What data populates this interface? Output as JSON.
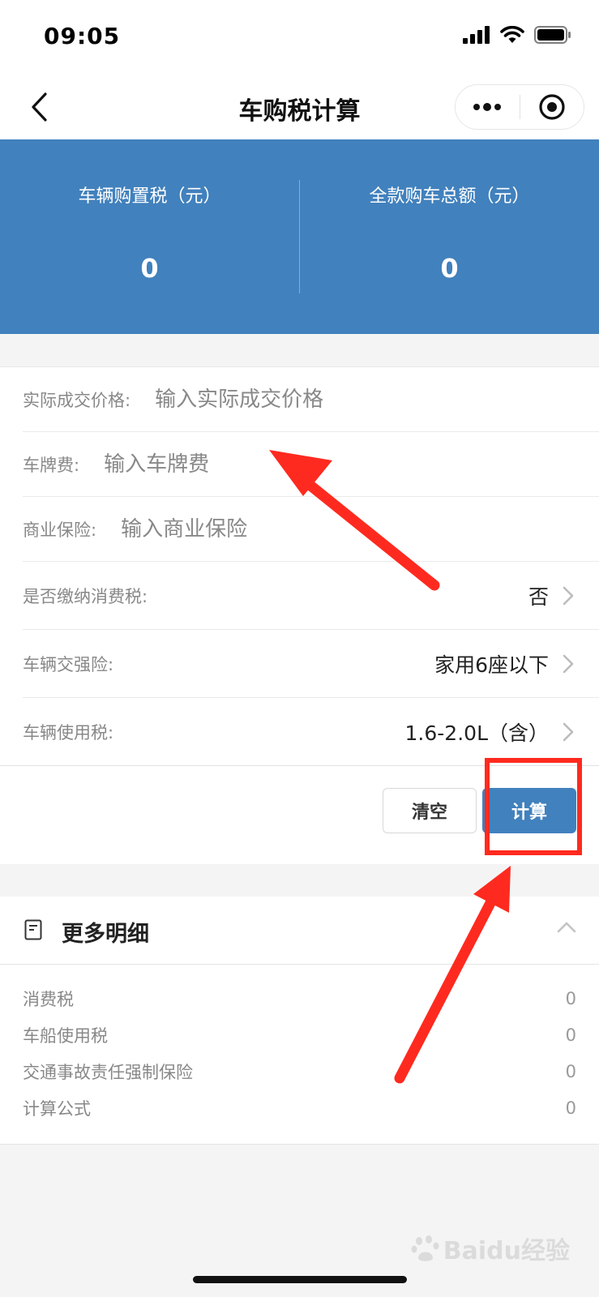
{
  "status_bar": {
    "time": "09:05"
  },
  "nav": {
    "title": "车购税计算"
  },
  "summary": {
    "purchase_tax": {
      "label": "车辆购置税（元）",
      "value": "0"
    },
    "total_amount": {
      "label": "全款购车总额（元）",
      "value": "0"
    }
  },
  "form": {
    "price": {
      "label": "实际成交价格:",
      "placeholder": "输入实际成交价格"
    },
    "plate_fee": {
      "label": "车牌费:",
      "placeholder": "输入车牌费"
    },
    "insurance": {
      "label": "商业保险:",
      "placeholder": "输入商业保险"
    },
    "consumption_tax": {
      "label": "是否缴纳消费税:",
      "value": "否"
    },
    "compulsory_insurance": {
      "label": "车辆交强险:",
      "value": "家用6座以下"
    },
    "usage_tax": {
      "label": "车辆使用税:",
      "value": "1.6-2.0L（含）"
    },
    "clear_label": "清空",
    "calc_label": "计算"
  },
  "details": {
    "title": "更多明细",
    "rows": [
      {
        "label": "消费税",
        "value": "0"
      },
      {
        "label": "车船使用税",
        "value": "0"
      },
      {
        "label": "交通事故责任强制保险",
        "value": "0"
      },
      {
        "label": "计算公式",
        "value": "0"
      }
    ]
  },
  "watermark": {
    "text": "Baidu经验"
  },
  "colors": {
    "header_blue": "#4181bd",
    "annotation_red": "#ff2a1f"
  }
}
